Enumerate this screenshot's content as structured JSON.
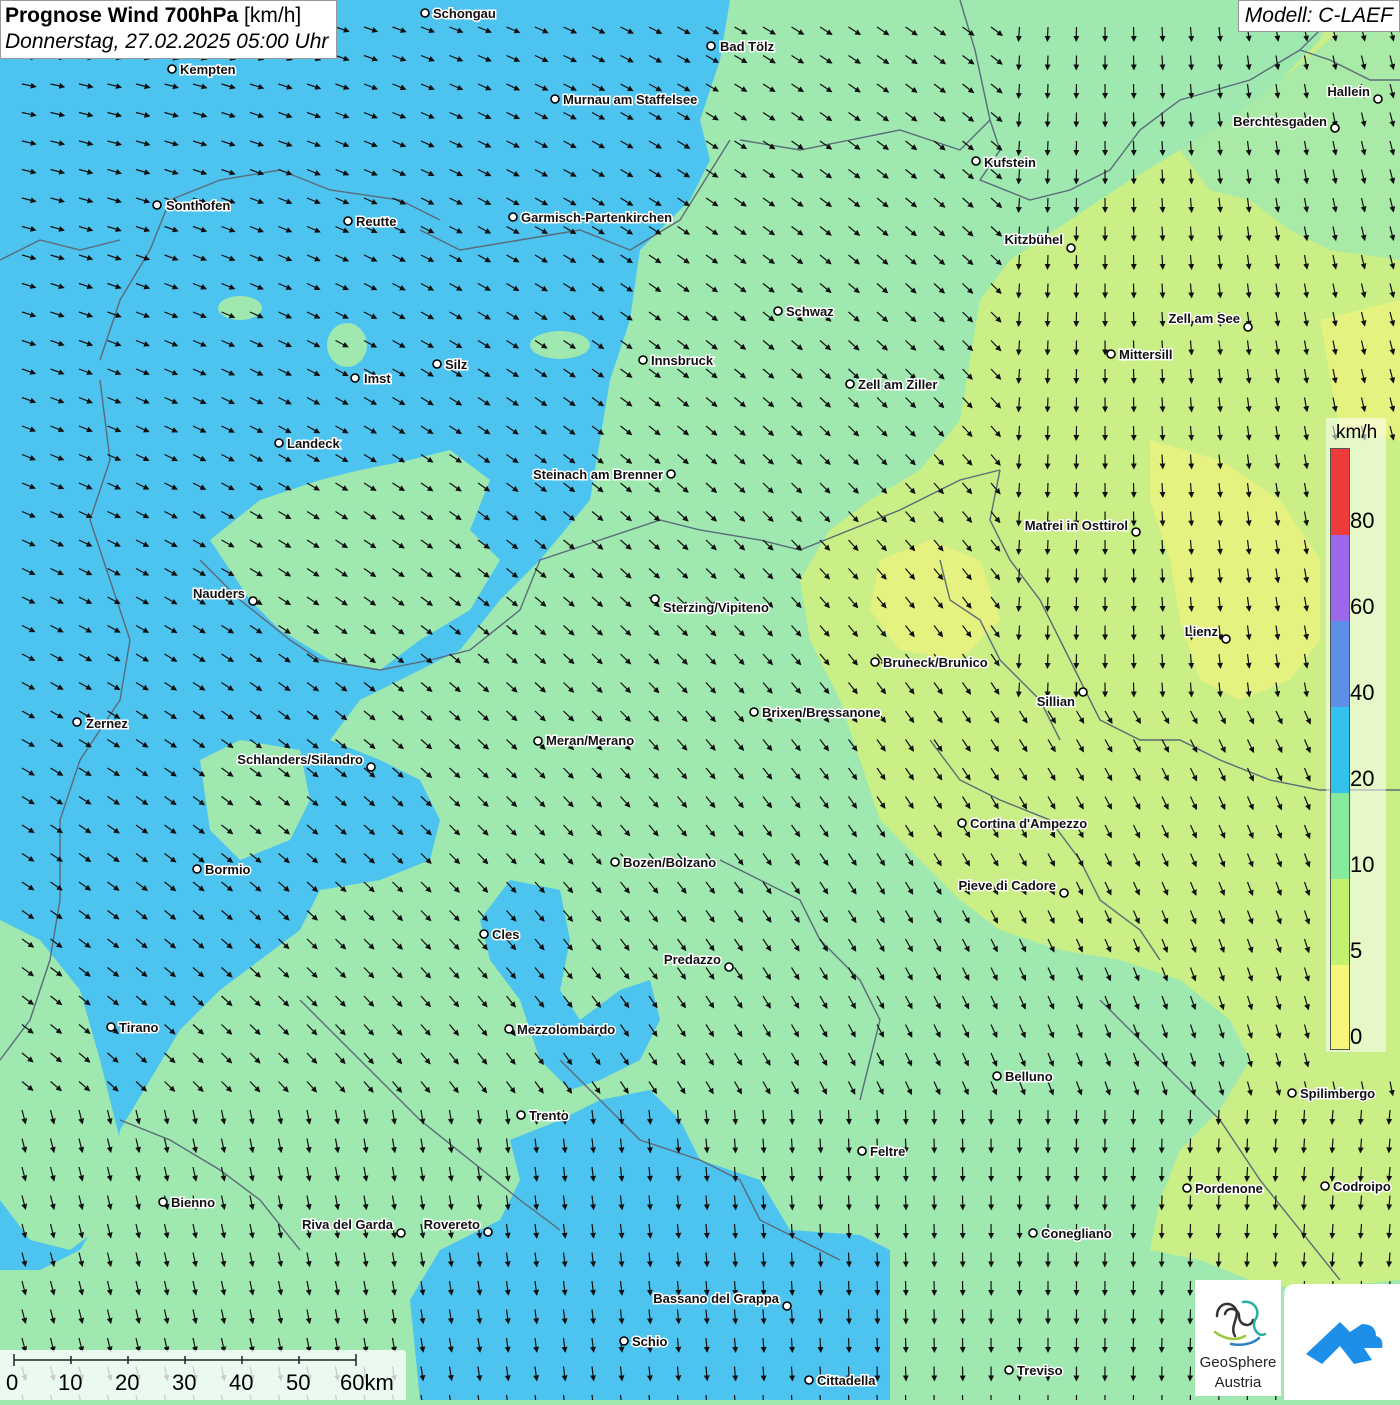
{
  "title": {
    "main_bold": "Prognose Wind 700hPa",
    "main_unit": "[km/h]",
    "date": "Donnerstag, 27.02.2025 05:00 Uhr"
  },
  "model": "Modell: C-LAEF",
  "legend": {
    "unit": "km/h",
    "labels": [
      "80",
      "60",
      "40",
      "20",
      "10",
      "5",
      "0"
    ],
    "colors": [
      "#ef3b3b",
      "#9a68e8",
      "#5e8fe8",
      "#31c3ee",
      "#86ea9c",
      "#c4f070",
      "#f6f678"
    ]
  },
  "scale": {
    "labels": [
      "0",
      "10",
      "20",
      "30",
      "40",
      "50",
      "60km"
    ]
  },
  "logos": {
    "geosphere_line1": "GeoSphere",
    "geosphere_line2": "Austria"
  },
  "map_colors": {
    "strong_blue": "#4dc3f0",
    "green": "#9fe8b0",
    "lime": "#c9ef86",
    "yellow": "#e6f280"
  },
  "cities": [
    {
      "name": "Schongau"
    },
    {
      "name": "Bad Tölz"
    },
    {
      "name": "Kempten"
    },
    {
      "name": "Murnau am Staffelsee"
    },
    {
      "name": "Hallein"
    },
    {
      "name": "Berchtesgaden"
    },
    {
      "name": "Kufstein"
    },
    {
      "name": "Sonthofen"
    },
    {
      "name": "Reutte"
    },
    {
      "name": "Garmisch-Partenkirchen"
    },
    {
      "name": "Kitzbühel"
    },
    {
      "name": "Schwaz"
    },
    {
      "name": "Zell am See"
    },
    {
      "name": "Mittersill"
    },
    {
      "name": "Innsbruck"
    },
    {
      "name": "Silz"
    },
    {
      "name": "Imst"
    },
    {
      "name": "Zell am Ziller"
    },
    {
      "name": "Landeck"
    },
    {
      "name": "Steinach am Brenner"
    },
    {
      "name": "Matrei in Osttirol"
    },
    {
      "name": "Nauders"
    },
    {
      "name": "Sterzing/Vipiteno"
    },
    {
      "name": "Lienz"
    },
    {
      "name": "Bruneck/Brunico"
    },
    {
      "name": "Sillian"
    },
    {
      "name": "Zernez"
    },
    {
      "name": "Brixen/Bressanone"
    },
    {
      "name": "Meran/Merano"
    },
    {
      "name": "Schlanders/Silandro"
    },
    {
      "name": "Cortina d'Ampezzo"
    },
    {
      "name": "Bozen/Bolzano"
    },
    {
      "name": "Bormio"
    },
    {
      "name": "Pieve di Cadore"
    },
    {
      "name": "Cles"
    },
    {
      "name": "Predazzo"
    },
    {
      "name": "Tirano"
    },
    {
      "name": "Mezzolombardo"
    },
    {
      "name": "Belluno"
    },
    {
      "name": "Spilimbergo"
    },
    {
      "name": "Trento"
    },
    {
      "name": "Feltre"
    },
    {
      "name": "Pordenone"
    },
    {
      "name": "Codroipo"
    },
    {
      "name": "Bienno"
    },
    {
      "name": "Riva del Garda"
    },
    {
      "name": "Rovereto"
    },
    {
      "name": "Conegliano"
    },
    {
      "name": "Bassano del Grappa"
    },
    {
      "name": "Schio"
    },
    {
      "name": "Treviso"
    },
    {
      "name": "Cittadella"
    }
  ]
}
